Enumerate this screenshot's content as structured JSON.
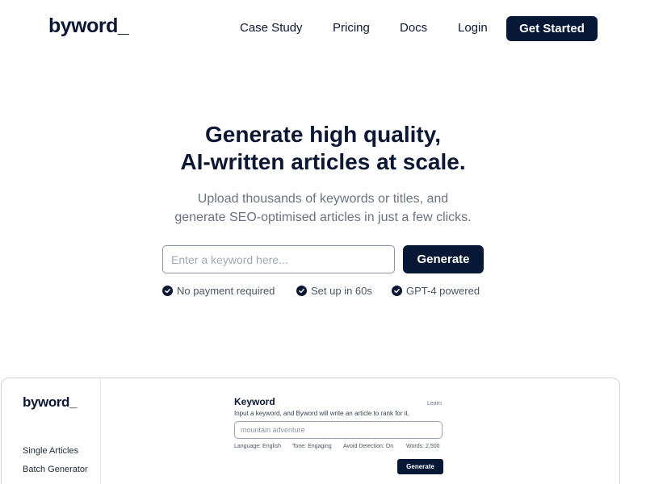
{
  "header": {
    "logo": "byword_",
    "nav": [
      "Case Study",
      "Pricing",
      "Docs",
      "Login"
    ],
    "cta": "Get Started"
  },
  "hero": {
    "title_line1": "Generate high quality,",
    "title_line2": "AI-written articles at scale.",
    "subtitle_line1": "Upload thousands of keywords or titles, and",
    "subtitle_line2": "generate SEO-optimised articles in just a few clicks.",
    "input_placeholder": "Enter a keyword here...",
    "generate_label": "Generate",
    "features": [
      "No payment required",
      "Set up in 60s",
      "GPT-4 powered"
    ]
  },
  "preview": {
    "logo": "byword_",
    "sidebar_items": [
      "Single Articles",
      "Batch Generator"
    ],
    "keyword_title": "Keyword",
    "learn_label": "Learn",
    "description": "Input a keyword, and Byword will write an article to rank for it.",
    "input_placeholder": "mountain adventure",
    "meta": [
      "Language: English",
      "Tone: Engaging",
      "Avoid Detection: On",
      "Words: 2,500"
    ],
    "generate_label": "Generate"
  },
  "colors": {
    "brand_dark": "#071836",
    "text_primary": "#0b1733",
    "text_muted": "#6b7280"
  },
  "icons": {
    "feature_check": "check-circle-icon"
  }
}
